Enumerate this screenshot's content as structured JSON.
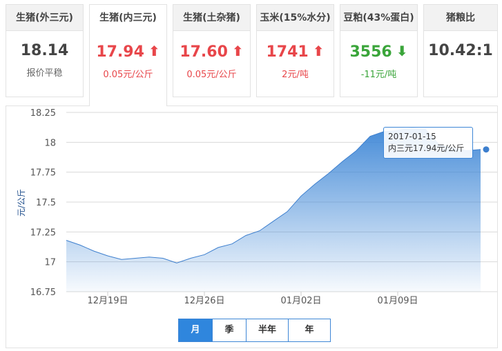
{
  "cards": [
    {
      "title": "生猪(外三元)",
      "value": "18.14",
      "sub": "报价平稳",
      "trend": "flat"
    },
    {
      "title": "生猪(内三元)",
      "value": "17.94",
      "sub": "0.05元/公斤",
      "trend": "up"
    },
    {
      "title": "生猪(土杂猪)",
      "value": "17.60",
      "sub": "0.05元/公斤",
      "trend": "up"
    },
    {
      "title": "玉米(15%水分)",
      "value": "1741",
      "sub": "2元/吨",
      "trend": "up"
    },
    {
      "title": "豆粕(43%蛋白)",
      "value": "3556",
      "sub": "-11元/吨",
      "trend": "down"
    },
    {
      "title": "猪粮比",
      "value": "10.42:1",
      "sub": "",
      "trend": "flat"
    }
  ],
  "icons": {
    "up": "arrow-up-icon",
    "down": "arrow-down-icon"
  },
  "colors": {
    "up": "#e8464a",
    "down": "#3aa53a",
    "line": "#3d7fce",
    "fill_top": "#3d86d6"
  },
  "tooltip": {
    "date": "2017-01-15",
    "text": "内三元17.94元/公斤"
  },
  "range_tabs": [
    "月",
    "季",
    "半年",
    "年"
  ],
  "range_selected": "月",
  "chart_data": {
    "type": "area",
    "ylabel": "元/公斤",
    "ylim": [
      16.75,
      18.25
    ],
    "yticks": [
      18.25,
      18,
      17.75,
      17.5,
      17.25,
      17,
      16.75
    ],
    "xticks": [
      "12月19日",
      "12月26日",
      "01月02日",
      "01月09日"
    ],
    "xtick_index": [
      3,
      10,
      17,
      24
    ],
    "grid": true,
    "x": [
      "12月16日",
      "12月17日",
      "12月18日",
      "12月19日",
      "12月20日",
      "12月21日",
      "12月22日",
      "12月23日",
      "12月24日",
      "12月25日",
      "12月26日",
      "12月27日",
      "12月28日",
      "12月29日",
      "12月30日",
      "12月31日",
      "01月01日",
      "01月02日",
      "01月03日",
      "01月04日",
      "01月05日",
      "01月06日",
      "01月07日",
      "01月08日",
      "01月09日",
      "01月10日",
      "01月11日",
      "01月12日",
      "01月13日",
      "01月14日",
      "01月15日"
    ],
    "series": [
      {
        "values": [
          17.18,
          17.14,
          17.09,
          17.05,
          17.02,
          17.03,
          17.04,
          17.03,
          16.99,
          17.03,
          17.06,
          17.12,
          17.15,
          17.22,
          17.26,
          17.34,
          17.42,
          17.55,
          17.65,
          17.74,
          17.84,
          17.93,
          18.05,
          18.09,
          18.1,
          18.12,
          18.11,
          17.98,
          17.95,
          17.93,
          17.94
        ]
      }
    ]
  }
}
